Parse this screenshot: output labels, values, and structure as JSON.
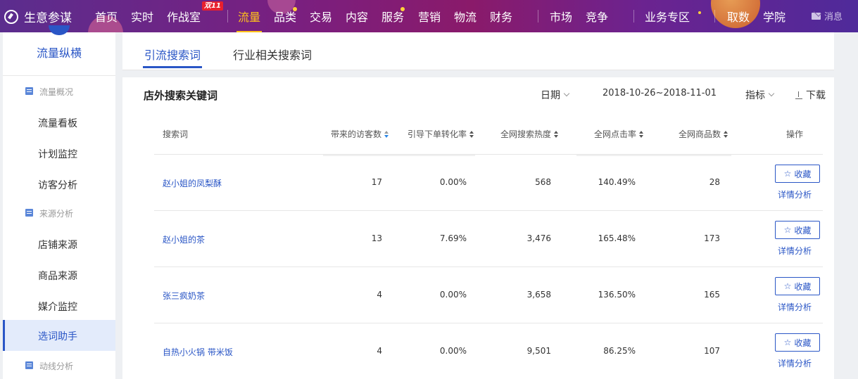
{
  "app": {
    "title": "生意参谋"
  },
  "nav": {
    "items": [
      "首页",
      "实时",
      "作战室",
      "流量",
      "品类",
      "交易",
      "内容",
      "服务",
      "营销",
      "物流",
      "财务",
      "市场",
      "竞争",
      "业务专区",
      "取数",
      "学院"
    ],
    "active": "流量",
    "badge": "双11",
    "message": "消息"
  },
  "sidebar": {
    "title": "流量纵横",
    "groups": [
      {
        "label": "流量概况",
        "items": [
          "流量看板",
          "计划监控",
          "访客分析"
        ]
      },
      {
        "label": "来源分析",
        "items": [
          "店铺来源",
          "商品来源",
          "媒介监控",
          "选词助手"
        ]
      },
      {
        "label": "动线分析",
        "items": []
      }
    ],
    "active": "选词助手"
  },
  "tabs": [
    {
      "label": "引流搜索词",
      "active": true
    },
    {
      "label": "行业相关搜索词",
      "active": false
    }
  ],
  "card": {
    "title": "店外搜索关键词",
    "date_label": "日期",
    "date_range": "2018-10-26~2018-11-01",
    "metric_label": "指标",
    "download_label": "下载"
  },
  "table": {
    "headers": [
      "搜索词",
      "带来的访客数",
      "引导下单转化率",
      "全网搜索热度",
      "全网点击率",
      "全网商品数",
      "操作"
    ],
    "rows": [
      {
        "keyword": "赵小姐的凤梨酥",
        "visitors": "17",
        "conversion": "0.00%",
        "heat": "568",
        "ctr": "140.49%",
        "products": "28"
      },
      {
        "keyword": "赵小姐的茶",
        "visitors": "13",
        "conversion": "7.69%",
        "heat": "3,476",
        "ctr": "165.48%",
        "products": "173"
      },
      {
        "keyword": "张三疯奶茶",
        "visitors": "4",
        "conversion": "0.00%",
        "heat": "3,658",
        "ctr": "136.50%",
        "products": "165"
      },
      {
        "keyword": "自热小火锅 带米饭",
        "visitors": "4",
        "conversion": "0.00%",
        "heat": "9,501",
        "ctr": "86.25%",
        "products": "107"
      }
    ],
    "fav_label": "收藏",
    "detail_label": "详情分析"
  }
}
